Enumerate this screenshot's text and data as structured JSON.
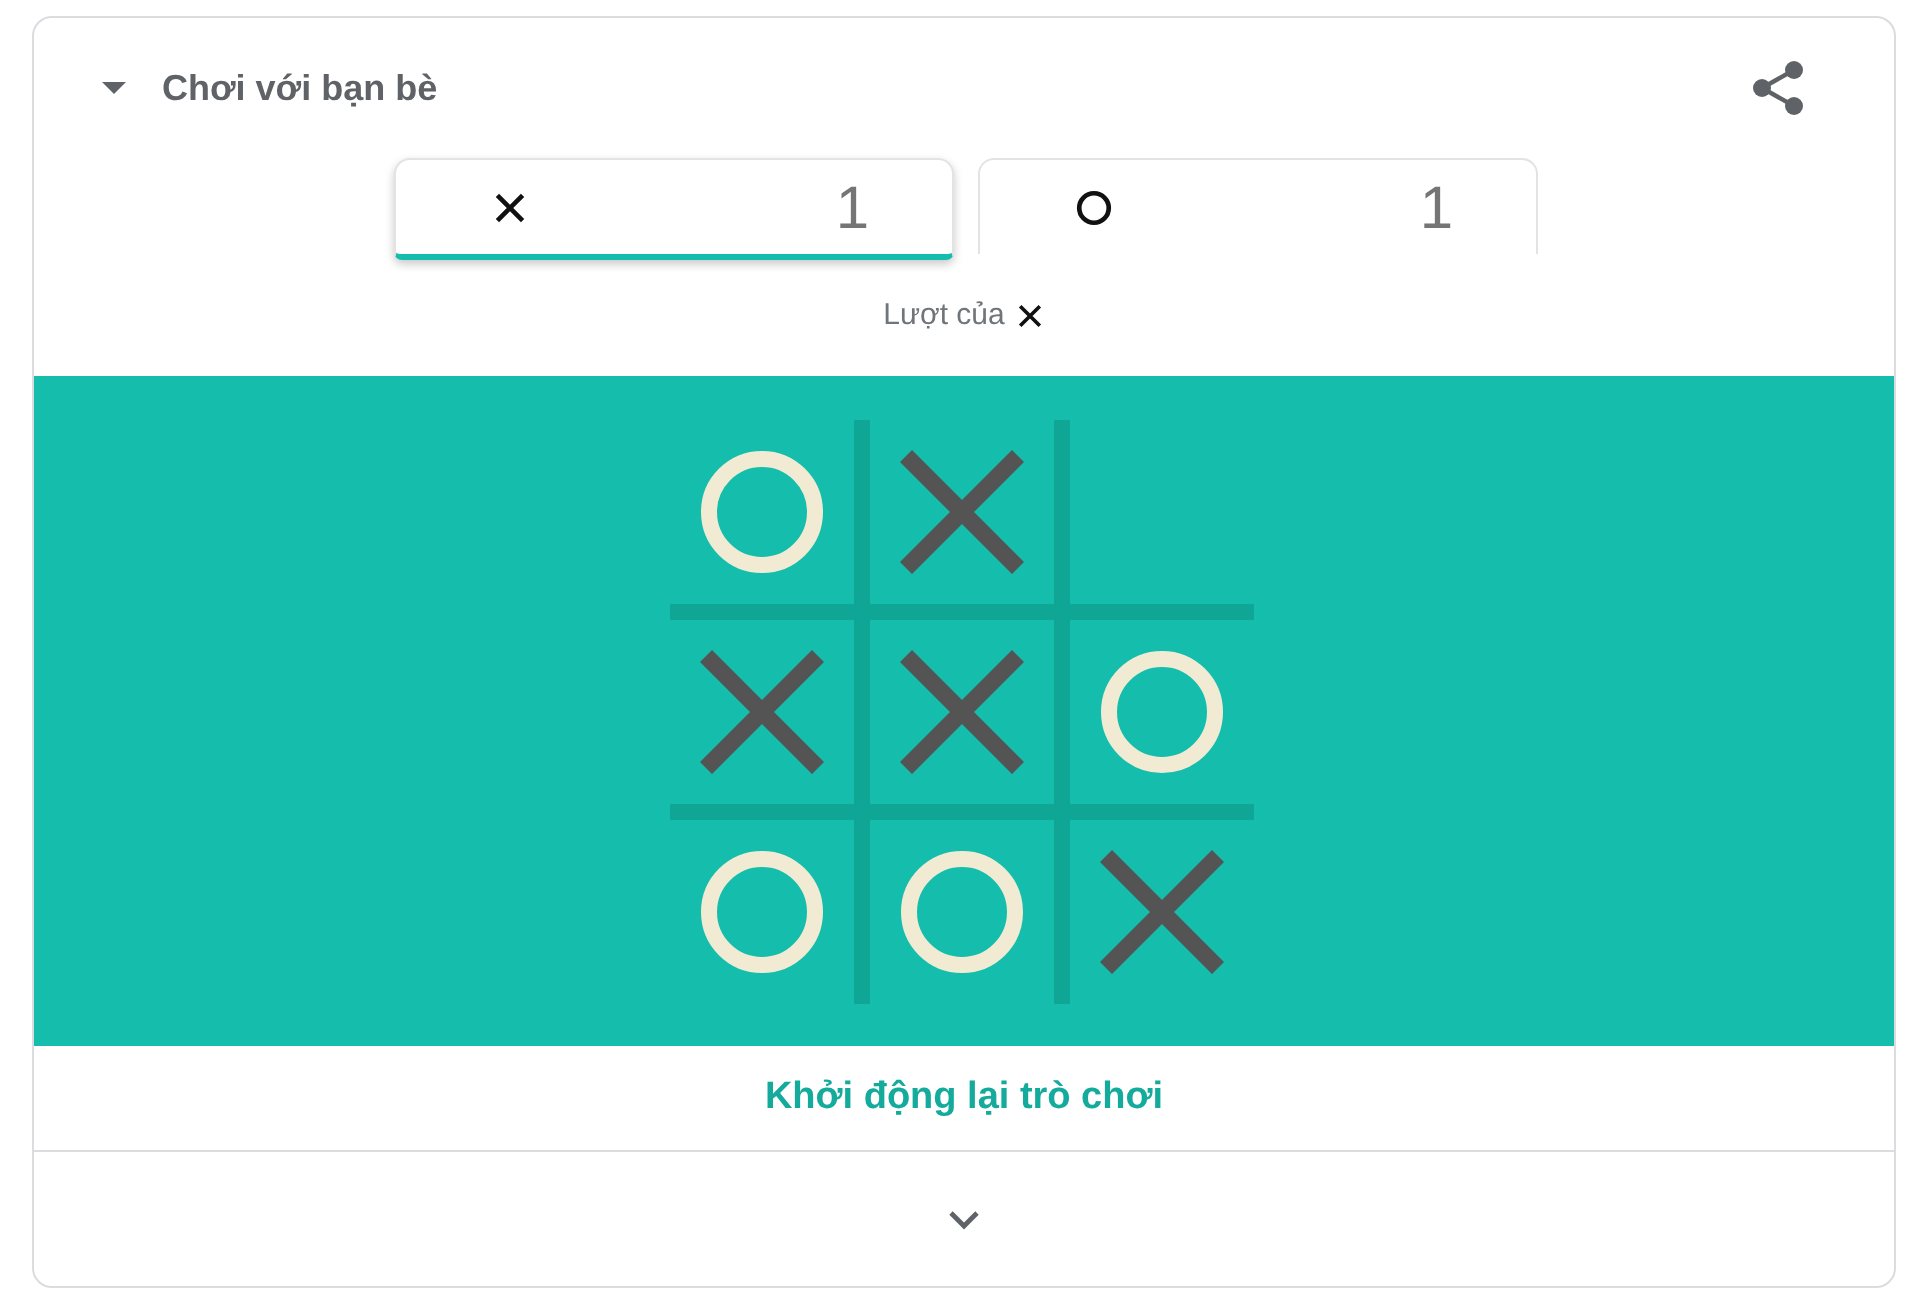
{
  "header": {
    "title": "Chơi với bạn bè",
    "expanded": true
  },
  "players": [
    {
      "kind": "cross",
      "score": "1",
      "selected": true
    },
    {
      "kind": "ring",
      "score": "1",
      "selected": false
    }
  ],
  "turn": {
    "label": "Lượt của",
    "kind": "cross"
  },
  "board": {
    "cells": [
      {
        "kind": "ring"
      },
      {
        "kind": "cross"
      },
      {
        "kind": "empty"
      },
      {
        "kind": "cross"
      },
      {
        "kind": "cross"
      },
      {
        "kind": "ring"
      },
      {
        "kind": "ring"
      },
      {
        "kind": "ring"
      },
      {
        "kind": "cross"
      }
    ]
  },
  "restart": "Khởi động lại trò chơi"
}
